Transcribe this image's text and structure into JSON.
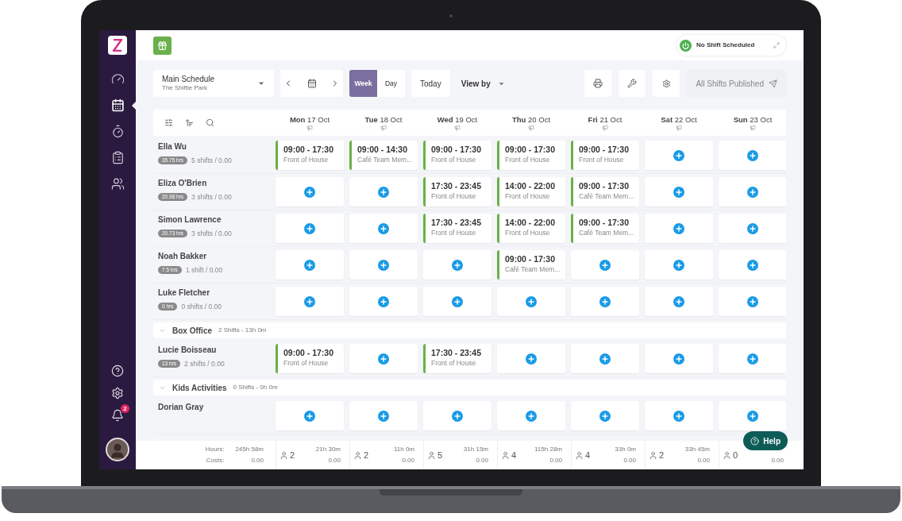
{
  "sidebar": {
    "items": [
      {
        "kind": "dashboard",
        "selected": false
      },
      {
        "kind": "calendar",
        "selected": true
      },
      {
        "kind": "timer",
        "selected": false
      },
      {
        "kind": "clipboard",
        "selected": false
      },
      {
        "kind": "team",
        "selected": false
      }
    ],
    "bottom": [
      {
        "kind": "help"
      },
      {
        "kind": "settings"
      },
      {
        "kind": "notifications",
        "badge": "2"
      }
    ]
  },
  "status": {
    "label": "No Shift Scheduled"
  },
  "schedule": {
    "title": "Main Schedule",
    "subtitle": "The Shiftie Park"
  },
  "view_tabs": [
    {
      "label": "Week",
      "selected": true
    },
    {
      "label": "Day",
      "selected": false
    }
  ],
  "today": "Today",
  "view_by": "View by",
  "published": "All Shifts Published",
  "days": [
    {
      "day": "Mon",
      "date": "17 Oct"
    },
    {
      "day": "Tue",
      "date": "18 Oct"
    },
    {
      "day": "Wed",
      "date": "19 Oct"
    },
    {
      "day": "Thu",
      "date": "20 Oct"
    },
    {
      "day": "Fri",
      "date": "21 Oct"
    },
    {
      "day": "Sat",
      "date": "22 Oct"
    },
    {
      "day": "Sun",
      "date": "23 Oct"
    }
  ],
  "rows": [
    {
      "kind": "employee",
      "name": "Ella Wu",
      "hours": "35.75 hrs",
      "shifts": "5 shifts / 0.00",
      "cells": [
        {
          "kind": "shift",
          "time": "09:00 - 17:30",
          "role": "Front of House"
        },
        {
          "kind": "shift",
          "time": "09:00 - 14:30",
          "role": "Café Team Mem..."
        },
        {
          "kind": "shift",
          "time": "09:00 - 17:30",
          "role": "Front of House"
        },
        {
          "kind": "shift",
          "time": "09:00 - 17:30",
          "role": "Front of House"
        },
        {
          "kind": "shift",
          "time": "09:00 - 17:30",
          "role": "Front of House"
        },
        {
          "kind": "empty"
        },
        {
          "kind": "empty"
        }
      ]
    },
    {
      "kind": "employee",
      "name": "Eliza O'Brien",
      "hours": "20.98 hrs",
      "shifts": "3 shifts / 0.00",
      "cells": [
        {
          "kind": "empty"
        },
        {
          "kind": "empty"
        },
        {
          "kind": "shift",
          "time": "17:30 - 23:45",
          "role": "Front of House"
        },
        {
          "kind": "shift",
          "time": "14:00 - 22:00",
          "role": "Front of House"
        },
        {
          "kind": "shift",
          "time": "09:00 - 17:30",
          "role": "Café Team Mem..."
        },
        {
          "kind": "empty"
        },
        {
          "kind": "empty"
        }
      ]
    },
    {
      "kind": "employee",
      "name": "Simon Lawrence",
      "hours": "20.73 hrs",
      "shifts": "3 shifts / 0.00",
      "cells": [
        {
          "kind": "empty"
        },
        {
          "kind": "empty"
        },
        {
          "kind": "shift",
          "time": "17:30 - 23:45",
          "role": "Front of House"
        },
        {
          "kind": "shift",
          "time": "14:00 - 22:00",
          "role": "Front of House"
        },
        {
          "kind": "shift",
          "time": "09:00 - 17:30",
          "role": "Café Team Mem..."
        },
        {
          "kind": "empty"
        },
        {
          "kind": "empty"
        }
      ]
    },
    {
      "kind": "employee",
      "name": "Noah Bakker",
      "hours": "7.5 hrs",
      "shifts": "1 shift / 0.00",
      "cells": [
        {
          "kind": "empty"
        },
        {
          "kind": "empty"
        },
        {
          "kind": "empty"
        },
        {
          "kind": "shift",
          "time": "09:00 - 17:30",
          "role": "Café Team Mem..."
        },
        {
          "kind": "empty"
        },
        {
          "kind": "empty"
        },
        {
          "kind": "empty"
        }
      ]
    },
    {
      "kind": "employee",
      "name": "Luke Fletcher",
      "hours": "0 hrs",
      "shifts": "0 shifts / 0.00",
      "cells": [
        {
          "kind": "empty"
        },
        {
          "kind": "empty"
        },
        {
          "kind": "empty"
        },
        {
          "kind": "empty"
        },
        {
          "kind": "empty"
        },
        {
          "kind": "empty"
        },
        {
          "kind": "empty"
        }
      ]
    },
    {
      "kind": "group",
      "name": "Box Office",
      "summary": "2 Shifts - 13h 0m",
      "expanded": true
    },
    {
      "kind": "employee",
      "name": "Lucie Boisseau",
      "hours": "13 hrs",
      "shifts": "2 shifts / 0.00",
      "cells": [
        {
          "kind": "shift",
          "time": "09:00 - 17:30",
          "role": "Front of House"
        },
        {
          "kind": "empty"
        },
        {
          "kind": "shift",
          "time": "17:30 - 23:45",
          "role": "Front of House"
        },
        {
          "kind": "empty"
        },
        {
          "kind": "empty"
        },
        {
          "kind": "empty"
        },
        {
          "kind": "empty"
        }
      ]
    },
    {
      "kind": "group",
      "name": "Kids Activities",
      "summary": "0 Shifts - 0h 0m",
      "expanded": true
    },
    {
      "kind": "employee",
      "name": "Dorian Gray",
      "cells": [
        {
          "kind": "empty"
        },
        {
          "kind": "empty"
        },
        {
          "kind": "empty"
        },
        {
          "kind": "empty"
        },
        {
          "kind": "empty"
        },
        {
          "kind": "empty"
        },
        {
          "kind": "empty"
        }
      ]
    }
  ],
  "footer": {
    "hours_label": "Hours:",
    "costs_label": "Costs:",
    "total_hours": "245h 58m",
    "total_costs": "0.00",
    "days": [
      {
        "staff": "2",
        "hours": "21h 30m",
        "cost": "0.00"
      },
      {
        "staff": "2",
        "hours": "11h 0m",
        "cost": "0.00"
      },
      {
        "staff": "5",
        "hours": "31h 15m",
        "cost": "0.00"
      },
      {
        "staff": "4",
        "hours": "115h 28m",
        "cost": "0.00"
      },
      {
        "staff": "4",
        "hours": "33h 0m",
        "cost": "0.00"
      },
      {
        "staff": "2",
        "hours": "33h 45m",
        "cost": "0.00"
      },
      {
        "staff": "0",
        "cost": "0.00"
      }
    ]
  },
  "help": "Help"
}
